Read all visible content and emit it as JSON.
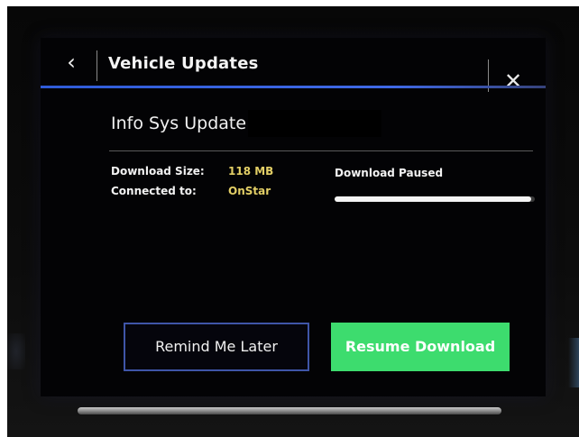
{
  "header": {
    "back_glyph": "‹",
    "title": "Vehicle Updates",
    "close_glyph": "✕"
  },
  "update": {
    "label": "Info Sys Update:",
    "download_size_label": "Download Size:",
    "download_size_value": "118 MB",
    "connected_label": "Connected to:",
    "connected_value": "OnStar",
    "status": "Download Paused",
    "progress_fraction": 0.98
  },
  "actions": {
    "remind_label": "Remind Me Later",
    "resume_label": "Resume Download"
  },
  "colors": {
    "accent_line": "#2f5bd8",
    "value_text": "#e3cf66",
    "resume_button": "#3ddc6e",
    "remind_border": "#3f55a8"
  },
  "icons": {
    "back": "chevron-left-icon",
    "close": "close-icon"
  }
}
